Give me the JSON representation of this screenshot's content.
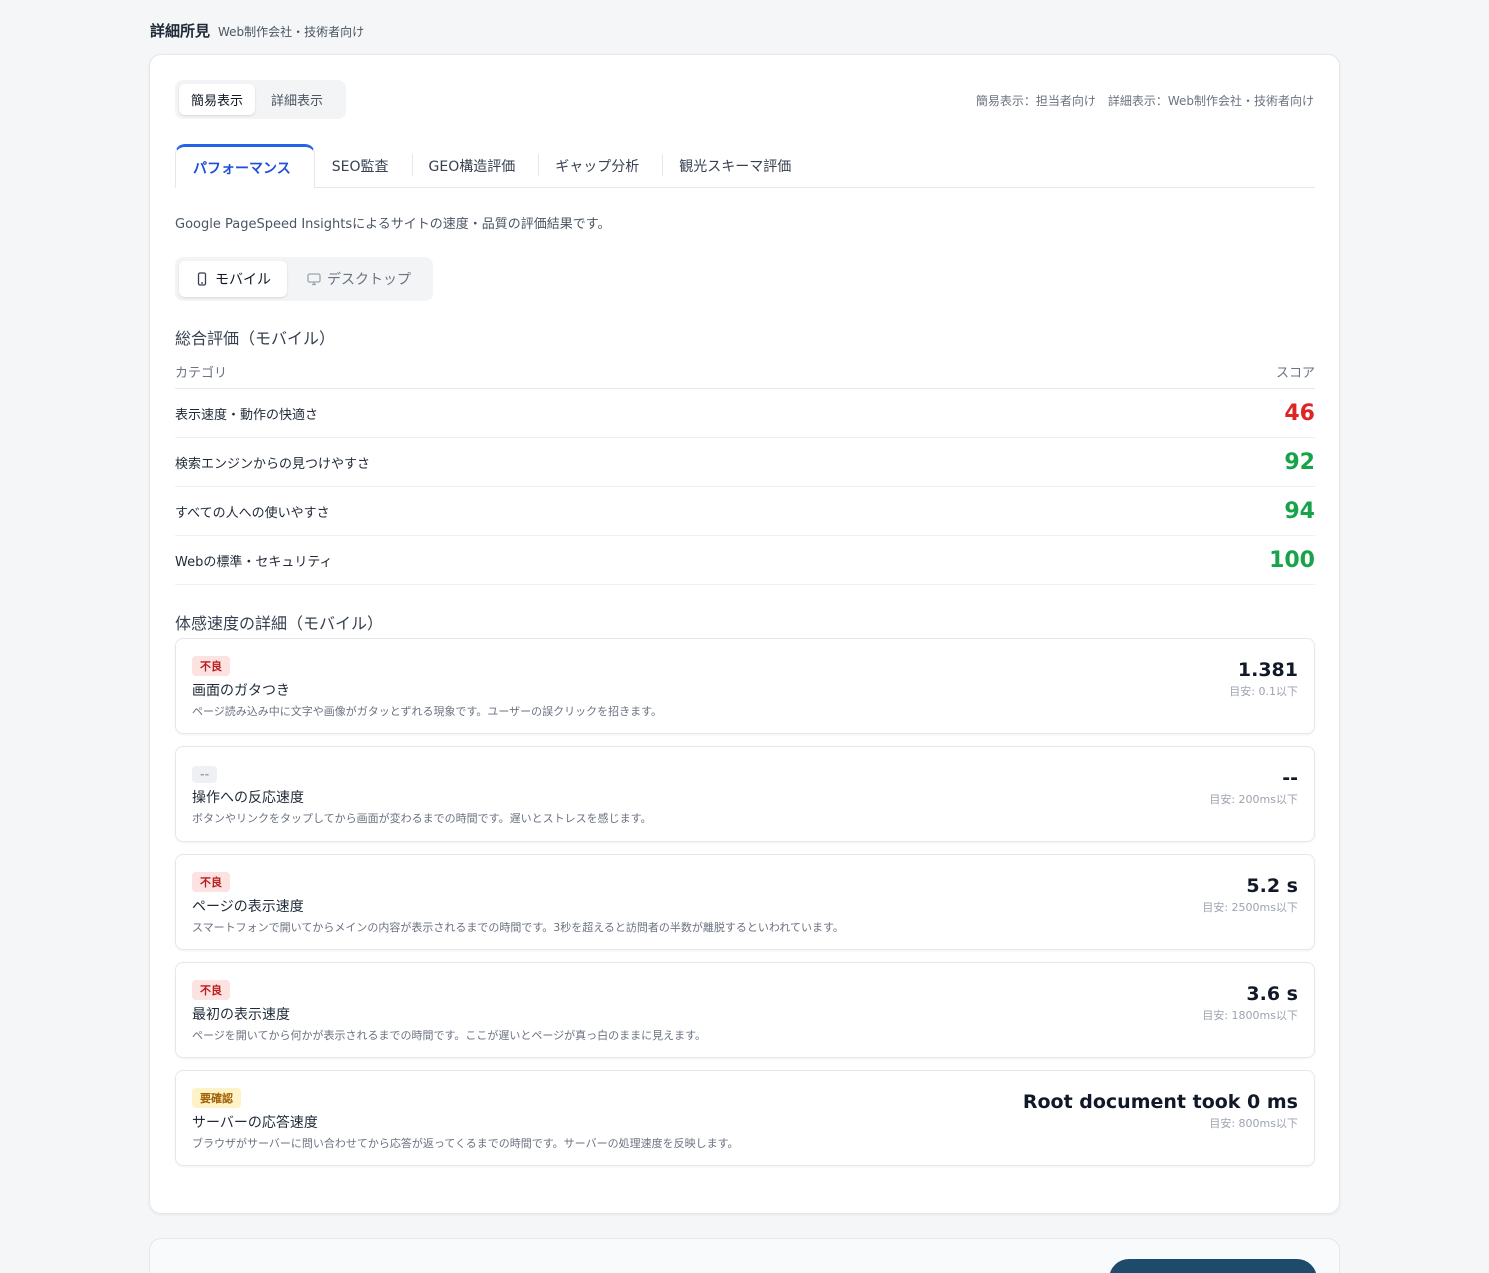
{
  "section": {
    "title": "詳細所見",
    "subtitle": "Web制作会社・技術者向け"
  },
  "mode_toggle": {
    "simple_label": "簡易表示",
    "detail_label": "詳細表示",
    "hint": "簡易表示：担当者向け　詳細表示：Web制作会社・技術者向け"
  },
  "tabs": [
    {
      "label": "パフォーマンス",
      "active": true
    },
    {
      "label": "SEO監査"
    },
    {
      "label": "GEO構造評価"
    },
    {
      "label": "ギャップ分析"
    },
    {
      "label": "観光スキーマ評価"
    }
  ],
  "description": "Google PageSpeed Insightsによるサイトの速度・品質の評価結果です。",
  "device_toggle": {
    "mobile_label": "モバイル",
    "desktop_label": "デスクトップ",
    "mobile_icon": "smartphone-icon",
    "desktop_icon": "monitor-icon"
  },
  "overall": {
    "title": "総合評価（モバイル）",
    "col_category": "カテゴリ",
    "col_score": "スコア",
    "rows": [
      {
        "label": "表示速度・動作の快適さ",
        "score": "46",
        "color": "#dc2626"
      },
      {
        "label": "検索エンジンからの見つけやすさ",
        "score": "92",
        "color": "#16a34a"
      },
      {
        "label": "すべての人への使いやすさ",
        "score": "94",
        "color": "#16a34a"
      },
      {
        "label": "Webの標準・セキュリティ",
        "score": "100",
        "color": "#16a34a"
      }
    ]
  },
  "details": {
    "title": "体感速度の詳細（モバイル）",
    "metrics": [
      {
        "badge": "不良",
        "badge_type": "bad",
        "name": "画面のガタつき",
        "desc": "ページ読み込み中に文字や画像がガタッとずれる現象です。ユーザーの誤クリックを招きます。",
        "value": "1.381",
        "target": "目安: 0.1以下"
      },
      {
        "badge": "--",
        "badge_type": "none",
        "name": "操作への反応速度",
        "desc": "ボタンやリンクをタップしてから画面が変わるまでの時間です。遅いとストレスを感じます。",
        "value": "--",
        "target": "目安: 200ms以下"
      },
      {
        "badge": "不良",
        "badge_type": "bad",
        "name": "ページの表示速度",
        "desc": "スマートフォンで開いてからメインの内容が表示されるまでの時間です。3秒を超えると訪問者の半数が離脱するといわれています。",
        "value": "5.2 s",
        "target": "目安: 2500ms以下"
      },
      {
        "badge": "不良",
        "badge_type": "bad",
        "name": "最初の表示速度",
        "desc": "ページを開いてから何かが表示されるまでの時間です。ここが遅いとページが真っ白のままに見えます。",
        "value": "3.6 s",
        "target": "目安: 1800ms以下"
      },
      {
        "badge": "要確認",
        "badge_type": "warn",
        "name": "サーバーの応答速度",
        "desc": "ブラウザがサーバーに問い合わせてから応答が返ってくるまでの時間です。サーバーの処理速度を反映します。",
        "value": "Root document took 0 ms",
        "target": "目安: 800ms以下"
      }
    ]
  }
}
